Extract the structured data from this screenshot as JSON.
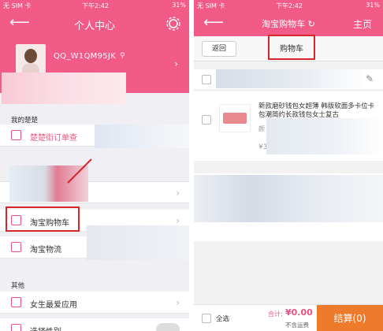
{
  "left": {
    "status": {
      "carrier": "无 SIM 卡",
      "time": "下午2:42",
      "battery": "31%"
    },
    "nav": {
      "title": "个人中心"
    },
    "profile": {
      "username": "QQ_W1QM95JK"
    },
    "sections": {
      "mine": "我的楚楚",
      "other": "其他"
    },
    "items": {
      "orders": "楚楚街订单查",
      "taobao_cart": "淘宝购物车",
      "taobao_logistics": "淘宝物流",
      "fav_apps": "女生最爱应用",
      "gender": "选择性别"
    }
  },
  "right": {
    "status": {
      "carrier": "无 SIM 卡",
      "time": "下午2:42",
      "battery": "31%"
    },
    "nav": {
      "title": "淘宝购物车",
      "home": "主页"
    },
    "back_button": "返回",
    "tab": "购物车",
    "product": {
      "title": "新款磨砂钱包女超薄 韩版软面多卡位卡包潮简约长款钱包女士复古",
      "spec": "颜",
      "price": "¥35."
    },
    "bottom": {
      "select_all": "全选",
      "total_label": "合计:",
      "total_value": "¥0.00",
      "shipping": "不含运费",
      "checkout": "结算(0)"
    }
  },
  "colors": {
    "brand_pink": "#f25a87",
    "checkout_orange": "#ee7a2c",
    "highlight_red": "#d8262d"
  }
}
